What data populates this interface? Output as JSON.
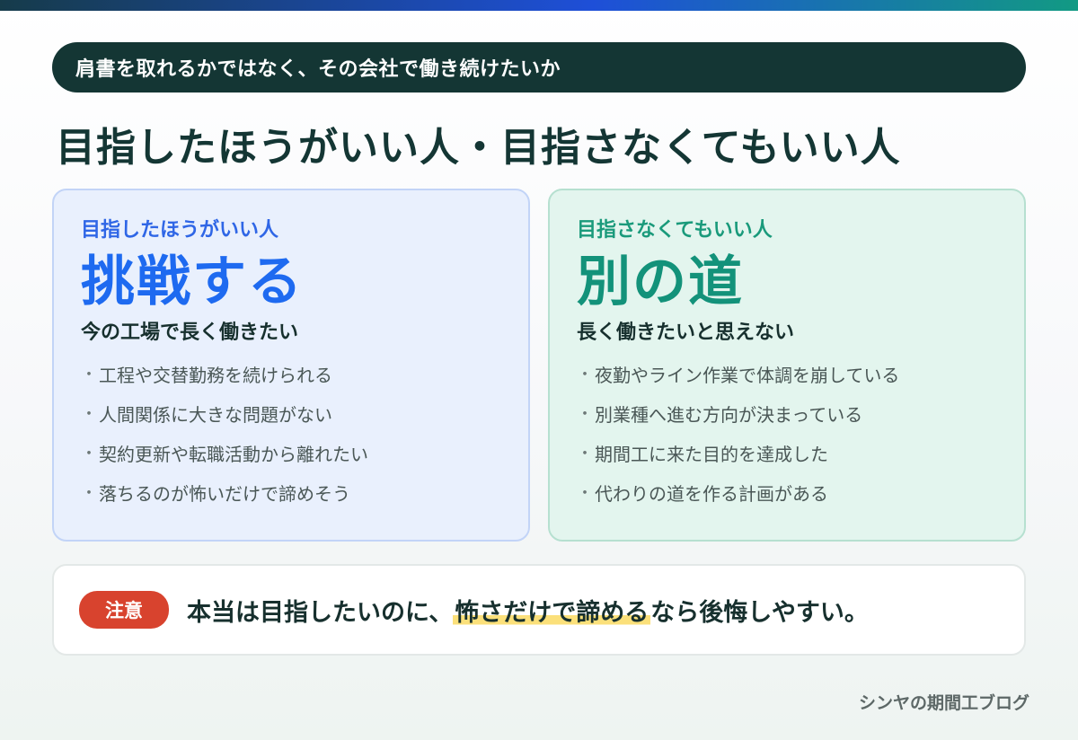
{
  "kicker": "肩書を取れるかではなく、その会社で働き続けたいか",
  "title": "目指したほうがいい人・目指さなくてもいい人",
  "cards": [
    {
      "label": "目指したほうがいい人",
      "headline": "挑戦する",
      "subtitle": "今の工場で長く働きたい",
      "items": [
        "工程や交替勤務を続けられる",
        "人間関係に大きな問題がない",
        "契約更新や転職活動から離れたい",
        "落ちるのが怖いだけで諦めそう"
      ],
      "accent": "#1e6af0"
    },
    {
      "label": "目指さなくてもいい人",
      "headline": "別の道",
      "subtitle": "長く働きたいと思えない",
      "items": [
        "夜勤やライン作業で体調を崩している",
        "別業種へ進む方向が決まっている",
        "期間工に来た目的を達成した",
        "代わりの道を作る計画がある"
      ],
      "accent": "#13927a"
    }
  ],
  "bullet_char": "・",
  "note": {
    "badge": "注意",
    "text_before": "本当は目指したいのに、",
    "text_highlight": "怖さだけで諦める",
    "text_after": "なら後悔しやすい。",
    "badge_color": "#d8432e",
    "highlight_color": "#fbe07a"
  },
  "brand": "シンヤの期間工ブログ"
}
